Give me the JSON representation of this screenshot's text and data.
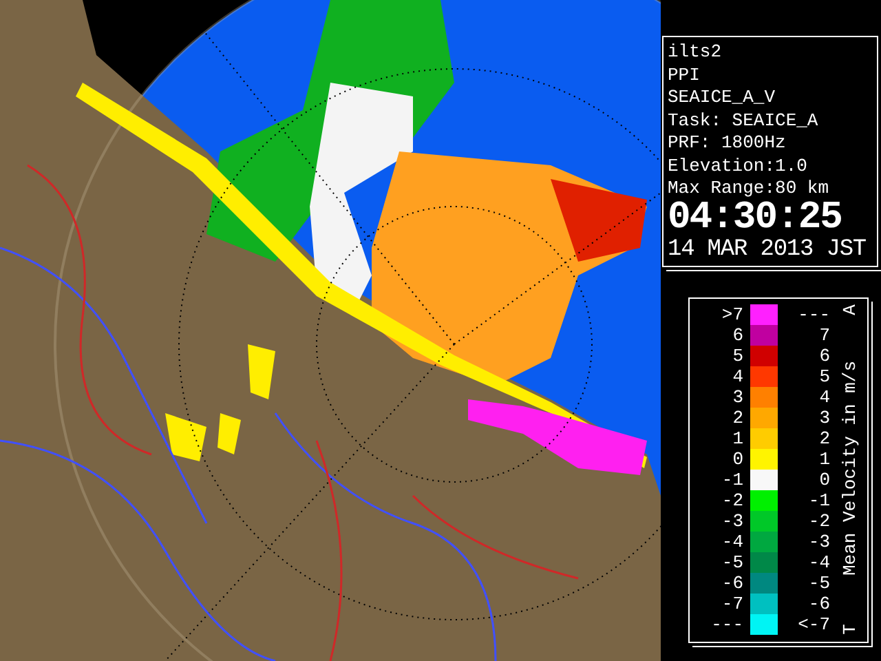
{
  "radar_info": {
    "lines": [
      "ilts2",
      "PPI",
      "SEAICE_A_V",
      "Task: SEAICE_A",
      "PRF: 1800Hz",
      "Elevation:1.0",
      "Max Range:80 km"
    ],
    "time": "04:30:25",
    "date": "14 MAR 2013 JST"
  },
  "legend": {
    "title": "Mean Velocity in m/s",
    "top_mark": "A",
    "bottom_mark": "T",
    "rows": [
      {
        "low": ">7",
        "high": "---",
        "color": "#ff20ff"
      },
      {
        "low": "6",
        "high": "7",
        "color": "#c000a0"
      },
      {
        "low": "5",
        "high": "6",
        "color": "#d00000"
      },
      {
        "low": "4",
        "high": "5",
        "color": "#ff3800"
      },
      {
        "low": "3",
        "high": "4",
        "color": "#ff8000"
      },
      {
        "low": "2",
        "high": "3",
        "color": "#ffa800"
      },
      {
        "low": "1",
        "high": "2",
        "color": "#ffcc00"
      },
      {
        "low": "0",
        "high": "1",
        "color": "#fff400"
      },
      {
        "low": "-1",
        "high": "0",
        "color": "#f8f8f8"
      },
      {
        "low": "-2",
        "high": "-1",
        "color": "#00f000"
      },
      {
        "low": "-3",
        "high": "-2",
        "color": "#00c828"
      },
      {
        "low": "-4",
        "high": "-3",
        "color": "#00a840"
      },
      {
        "low": "-5",
        "high": "-4",
        "color": "#008848"
      },
      {
        "low": "-6",
        "high": "-5",
        "color": "#008880"
      },
      {
        "low": "-7",
        "high": "-6",
        "color": "#00c0c0"
      },
      {
        "low": "---",
        "high": "<-7",
        "color": "#00f4f4"
      }
    ]
  }
}
